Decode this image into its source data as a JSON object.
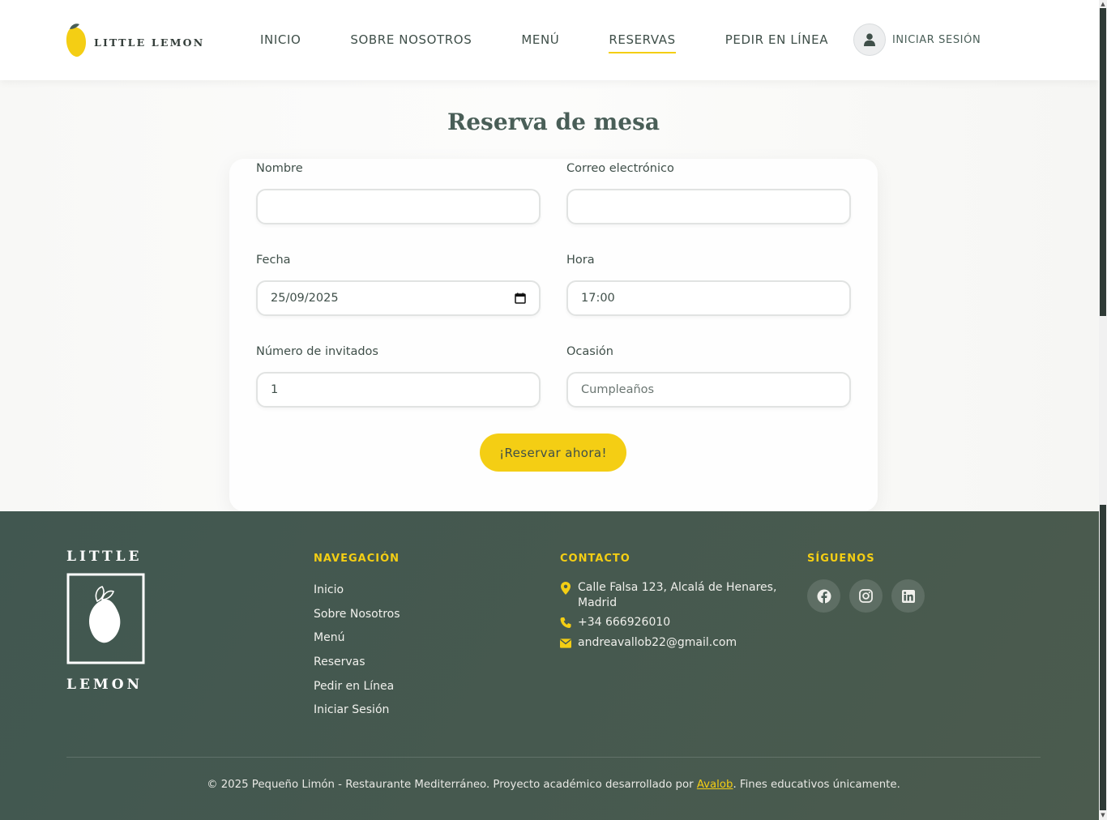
{
  "brand": {
    "name": "LITTLE LEMON",
    "footer_top": "LITTLE",
    "footer_bottom": "LEMON"
  },
  "nav": {
    "items": [
      {
        "label": "INICIO"
      },
      {
        "label": "SOBRE NOSOTROS"
      },
      {
        "label": "MENÚ"
      },
      {
        "label": "RESERVAS",
        "active": true
      },
      {
        "label": "PEDIR EN LÍNEA"
      }
    ],
    "login_label": "INICIAR SESIÓN"
  },
  "reservation": {
    "title": "Reserva de mesa",
    "name": {
      "label": "Nombre",
      "value": ""
    },
    "email": {
      "label": "Correo electrónico",
      "value": ""
    },
    "date": {
      "label": "Fecha",
      "value": "25/09/2025"
    },
    "time": {
      "label": "Hora",
      "value": "17:00"
    },
    "guests": {
      "label": "Número de invitados",
      "value": "1"
    },
    "occasion": {
      "label": "Ocasión",
      "value": "Cumpleaños"
    },
    "submit_label": "¡Reservar ahora!"
  },
  "footer": {
    "nav_heading": "NAVEGACIÓN",
    "nav_links": [
      "Inicio",
      "Sobre Nosotros",
      "Menú",
      "Reservas",
      "Pedir en Línea",
      "Iniciar Sesión"
    ],
    "contact_heading": "CONTACTO",
    "address_line1": "Calle Falsa 123, Alcalá de Henares,",
    "address_line2": "Madrid",
    "phone": "+34 666926010",
    "email": "andreavallob22@gmail.com",
    "social_heading": "SÍGUENOS",
    "social": [
      "facebook-icon",
      "instagram-icon",
      "linkedin-icon"
    ],
    "copyright_prefix": "© 2025 Pequeño Limón - Restaurante Mediterráneo. Proyecto académico desarrollado por ",
    "copyright_author": "Avalob",
    "copyright_suffix": ". Fines educativos únicamente."
  },
  "colors": {
    "accent": "#f4ce14",
    "primary": "#495e57",
    "footer_bg": "#46594f"
  }
}
